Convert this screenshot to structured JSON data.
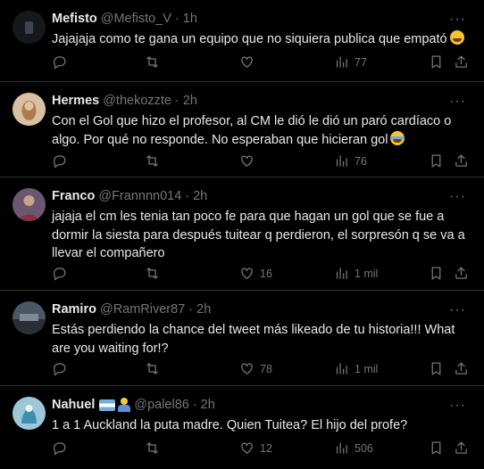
{
  "tweets": [
    {
      "name": "Mefisto",
      "handle": "@Mefisto_V",
      "dot": "·",
      "time": "1h",
      "text": "Jajajaja como te gana un equipo que no siquiera publica que empató",
      "emoji": "rolling-laughing-emoji",
      "views": "77",
      "replies": "",
      "reposts": "",
      "likes": ""
    },
    {
      "name": "Hermes",
      "handle": "@thekozzte",
      "dot": "·",
      "time": "2h",
      "text": "Con el Gol que hizo el profesor, al CM le dió le dió un paró cardíaco o algo. Por qué no responde. No esperaban que hicieran gol",
      "emoji": "crying-laughing-emoji",
      "views": "76",
      "replies": "",
      "reposts": "",
      "likes": ""
    },
    {
      "name": "Franco",
      "handle": "@Frannnn014",
      "dot": "·",
      "time": "2h",
      "text": "jajaja el cm les tenia tan poco fe para que hagan un gol que se fue a dormir la siesta para después tuitear q perdieron, el sorpresón q se va a llevar el compañero",
      "views": "1 mil",
      "replies": "",
      "reposts": "",
      "likes": "16"
    },
    {
      "name": "Ramiro",
      "handle": "@RamRiver87",
      "dot": "·",
      "time": "2h",
      "text": "Estás perdiendo la chance del tweet más likeado de tu historia!!! What are you waiting for!?",
      "views": "1 mil",
      "replies": "",
      "reposts": "",
      "likes": "78"
    },
    {
      "name": "Nahuel",
      "handle": "@palel86",
      "dot": "·",
      "time": "2h",
      "text": "1 a 1 Auckland la puta madre. Quien Tuitea? El hijo del profe?",
      "name_badges": [
        "argentina-flag-emoji",
        "person-emoji"
      ],
      "views": "506",
      "replies": "",
      "reposts": "",
      "likes": "12"
    }
  ],
  "more_label": "···",
  "colors": {
    "background": "#000000",
    "text": "#e7e9ea",
    "muted": "#71767b",
    "divider": "#2f3336"
  }
}
